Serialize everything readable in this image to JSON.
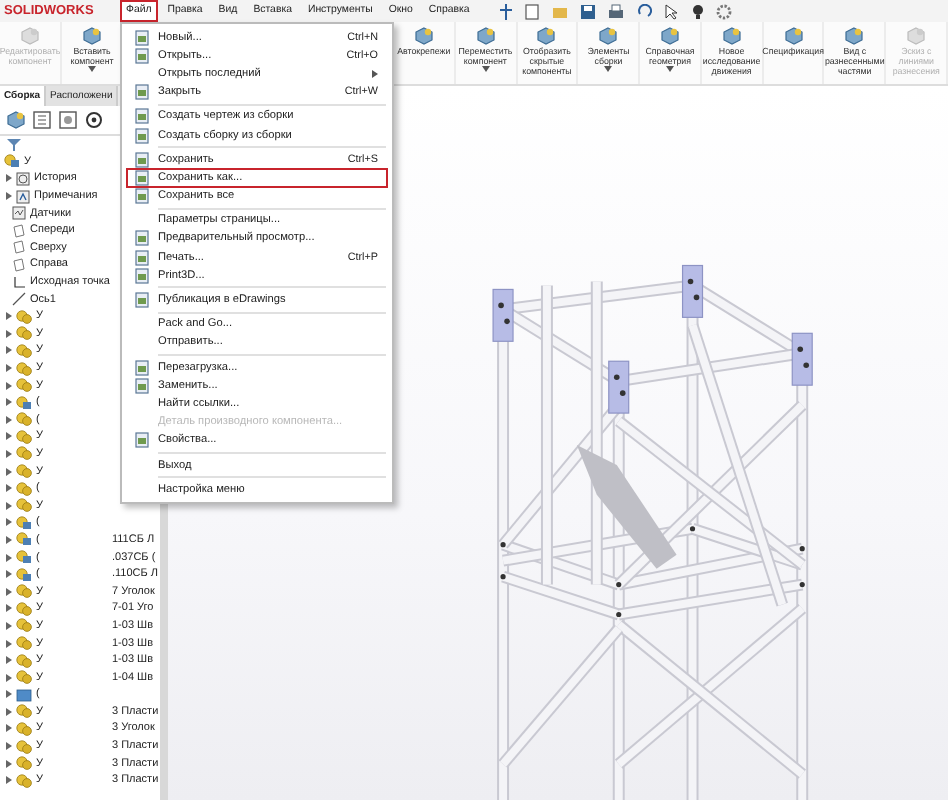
{
  "menubar": {
    "logo": "SOLIDWORKS",
    "menus": [
      {
        "label": "Файл",
        "selected": true
      },
      {
        "label": "Правка",
        "selected": false
      },
      {
        "label": "Вид",
        "selected": false
      },
      {
        "label": "Вставка",
        "selected": false
      },
      {
        "label": "Инструменты",
        "selected": false
      },
      {
        "label": "Окно",
        "selected": false
      },
      {
        "label": "Справка",
        "selected": false
      }
    ]
  },
  "ribbon": {
    "left": [
      {
        "label": "Редактировать компонент",
        "disabled": true,
        "dropdown": false
      },
      {
        "label": "Вставить компонент",
        "disabled": false,
        "dropdown": true
      }
    ],
    "right": [
      {
        "label": "Автокрепежи",
        "disabled": false,
        "dropdown": false
      },
      {
        "label": "Переместить компонент",
        "disabled": false,
        "dropdown": true
      },
      {
        "label": "Отобразить скрытые компоненты",
        "disabled": false,
        "dropdown": false
      },
      {
        "label": "Элементы сборки",
        "disabled": false,
        "dropdown": true
      },
      {
        "label": "Справочная геометрия",
        "disabled": false,
        "dropdown": true
      },
      {
        "label": "Новое исследование движения",
        "disabled": false,
        "dropdown": false
      },
      {
        "label": "Спецификация",
        "disabled": false,
        "dropdown": false
      },
      {
        "label": "Вид с разнесенными частями",
        "disabled": false,
        "dropdown": false
      },
      {
        "label": "Эскиз с линиями разнесения",
        "disabled": true,
        "dropdown": false
      }
    ]
  },
  "panel_tabs": [
    {
      "label": "Сборка",
      "selected": true
    },
    {
      "label": "Расположени",
      "selected": false
    }
  ],
  "tree": {
    "root": "У",
    "expanded": true,
    "items": [
      {
        "kind": "history",
        "label": "История",
        "expandable": true
      },
      {
        "kind": "notes",
        "label": "Примечания",
        "expandable": true
      },
      {
        "kind": "sensor",
        "label": "Датчики",
        "expandable": false
      },
      {
        "kind": "plane",
        "label": "Спереди",
        "expandable": false
      },
      {
        "kind": "plane",
        "label": "Сверху",
        "expandable": false
      },
      {
        "kind": "plane",
        "label": "Справа",
        "expandable": false
      },
      {
        "kind": "origin",
        "label": "Исходная точка",
        "expandable": false
      },
      {
        "kind": "axis",
        "label": "Ось1",
        "expandable": false
      }
    ],
    "components": [
      {
        "kind": "part",
        "prefix": "У"
      },
      {
        "kind": "part",
        "prefix": "У"
      },
      {
        "kind": "part",
        "prefix": "У"
      },
      {
        "kind": "part",
        "prefix": "У"
      },
      {
        "kind": "part",
        "prefix": "У"
      },
      {
        "kind": "assembly",
        "prefix": "("
      },
      {
        "kind": "part",
        "prefix": "("
      },
      {
        "kind": "part",
        "prefix": "У"
      },
      {
        "kind": "part",
        "prefix": "У"
      },
      {
        "kind": "part",
        "prefix": "У"
      },
      {
        "kind": "part",
        "prefix": "("
      },
      {
        "kind": "part",
        "prefix": "У"
      },
      {
        "kind": "assembly",
        "prefix": "("
      },
      {
        "kind": "assembly",
        "prefix": "(",
        "suffix": "111СБ Л"
      },
      {
        "kind": "assembly",
        "prefix": "(",
        "suffix": ".037СБ ("
      },
      {
        "kind": "assembly",
        "prefix": "(",
        "suffix": ".110СБ Л"
      },
      {
        "kind": "part",
        "prefix": "У",
        "suffix": "7 Уголок"
      },
      {
        "kind": "part",
        "prefix": "У",
        "suffix": "7-01 Уго"
      },
      {
        "kind": "part",
        "prefix": "У",
        "suffix": "1-03 Шв"
      },
      {
        "kind": "part",
        "prefix": "У",
        "suffix": "1-03 Шв"
      },
      {
        "kind": "part",
        "prefix": "У",
        "suffix": "1-03 Шв"
      },
      {
        "kind": "part",
        "prefix": "У",
        "suffix": "1-04 Шв"
      },
      {
        "kind": "folder",
        "prefix": "("
      },
      {
        "kind": "part",
        "prefix": "У",
        "suffix": "3 Пласти"
      },
      {
        "kind": "part",
        "prefix": "У",
        "suffix": "3 Уголок"
      },
      {
        "kind": "part",
        "prefix": "У",
        "suffix": "3 Пласти"
      },
      {
        "kind": "part",
        "prefix": "У",
        "suffix": "3 Пласти"
      },
      {
        "kind": "part",
        "prefix": "У",
        "suffix": "3 Пласти"
      }
    ]
  },
  "file_menu": [
    {
      "kind": "item",
      "label": "Новый...",
      "shortcut": "Ctrl+N",
      "has_icon": true,
      "disabled": false,
      "selected": false
    },
    {
      "kind": "item",
      "label": "Открыть...",
      "shortcut": "Ctrl+O",
      "has_icon": true,
      "disabled": false,
      "selected": false
    },
    {
      "kind": "item",
      "label": "Открыть последний",
      "submenu": true,
      "has_icon": false,
      "disabled": false,
      "selected": false
    },
    {
      "kind": "item",
      "label": "Закрыть",
      "shortcut": "Ctrl+W",
      "has_icon": true,
      "disabled": false,
      "selected": false
    },
    {
      "kind": "separator"
    },
    {
      "kind": "item",
      "label": "Создать чертеж из сборки",
      "has_icon": true,
      "disabled": false,
      "selected": false
    },
    {
      "kind": "item",
      "label": "Создать сборку из сборки",
      "has_icon": true,
      "disabled": false,
      "selected": false
    },
    {
      "kind": "separator"
    },
    {
      "kind": "item",
      "label": "Сохранить",
      "shortcut": "Ctrl+S",
      "has_icon": true,
      "disabled": false,
      "selected": false
    },
    {
      "kind": "item",
      "label": "Сохранить как...",
      "has_icon": true,
      "disabled": false,
      "selected": true
    },
    {
      "kind": "item",
      "label": "Сохранить все",
      "has_icon": true,
      "disabled": false,
      "selected": false
    },
    {
      "kind": "separator"
    },
    {
      "kind": "item",
      "label": "Параметры страницы...",
      "has_icon": false,
      "disabled": false,
      "selected": false
    },
    {
      "kind": "item",
      "label": "Предварительный просмотр...",
      "has_icon": true,
      "disabled": false,
      "selected": false
    },
    {
      "kind": "item",
      "label": "Печать...",
      "shortcut": "Ctrl+P",
      "has_icon": true,
      "disabled": false,
      "selected": false
    },
    {
      "kind": "item",
      "label": "Print3D...",
      "has_icon": true,
      "disabled": false,
      "selected": false
    },
    {
      "kind": "separator"
    },
    {
      "kind": "item",
      "label": "Публикация в eDrawings",
      "has_icon": true,
      "disabled": false,
      "selected": false
    },
    {
      "kind": "separator"
    },
    {
      "kind": "item",
      "label": "Pack and Go...",
      "has_icon": false,
      "disabled": false,
      "selected": false
    },
    {
      "kind": "item",
      "label": "Отправить...",
      "has_icon": false,
      "disabled": false,
      "selected": false
    },
    {
      "kind": "separator"
    },
    {
      "kind": "item",
      "label": "Перезагрузка...",
      "has_icon": true,
      "disabled": false,
      "selected": false
    },
    {
      "kind": "item",
      "label": "Заменить...",
      "has_icon": true,
      "disabled": false,
      "selected": false
    },
    {
      "kind": "item",
      "label": "Найти ссылки...",
      "has_icon": false,
      "disabled": false,
      "selected": false
    },
    {
      "kind": "item",
      "label": "Деталь производного компонента...",
      "has_icon": false,
      "disabled": true,
      "selected": false
    },
    {
      "kind": "item",
      "label": "Свойства...",
      "has_icon": true,
      "disabled": false,
      "selected": false
    },
    {
      "kind": "separator"
    },
    {
      "kind": "item",
      "label": "Выход",
      "has_icon": false,
      "disabled": false,
      "selected": false
    },
    {
      "kind": "separator"
    },
    {
      "kind": "item",
      "label": "Настройка меню",
      "has_icon": false,
      "disabled": false,
      "selected": false
    }
  ]
}
